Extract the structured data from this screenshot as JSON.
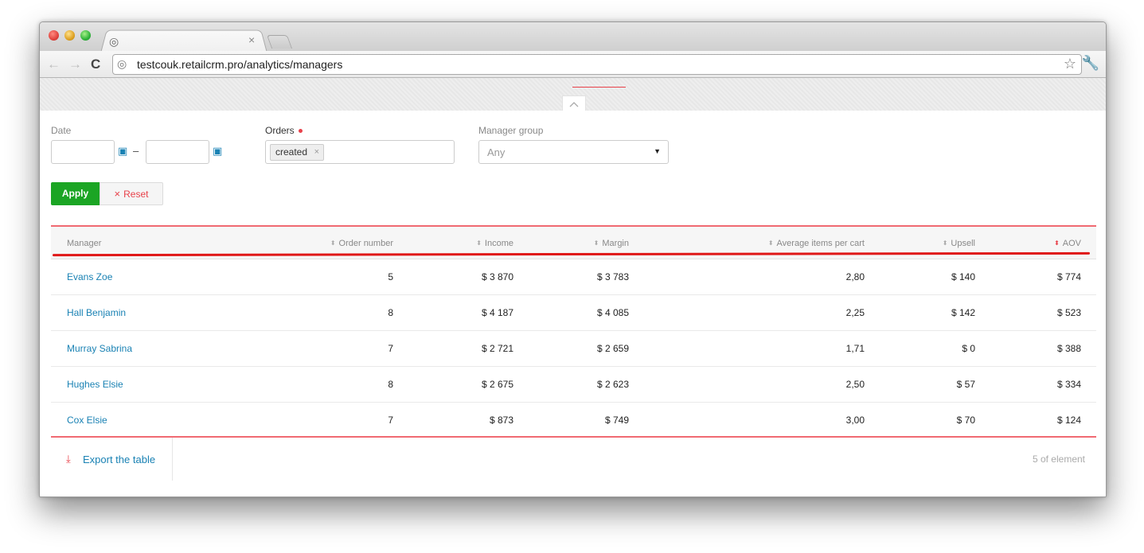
{
  "browser": {
    "url": "testcouk.retailcrm.pro/analytics/managers",
    "tab_close": "×",
    "back": "←",
    "forward": "→",
    "reload": "C",
    "star": "☆",
    "wrench": "🔧",
    "globe": "◎"
  },
  "filters": {
    "date_label": "Date",
    "date_dash": "–",
    "date_from": "",
    "date_to": "",
    "calendar_glyph": "▣",
    "orders_label": "Orders",
    "orders_tag": "created",
    "tag_remove": "×",
    "manager_group_label": "Manager group",
    "manager_group_value": "Any",
    "caret": "▼",
    "apply_label": "Apply",
    "reset_label": "Reset",
    "reset_glyph": "×"
  },
  "table": {
    "sort_glyph": "⬍",
    "columns": {
      "manager": "Manager",
      "order_number": "Order number",
      "income": "Income",
      "margin": "Margin",
      "avg_items": "Average items per cart",
      "upsell": "Upsell",
      "aov": "AOV"
    },
    "rows": [
      {
        "manager": "Evans Zoe",
        "order_number": "5",
        "income": "$ 3 870",
        "margin": "$ 3 783",
        "avg_items": "2,80",
        "upsell": "$ 140",
        "aov": "$ 774"
      },
      {
        "manager": "Hall Benjamin",
        "order_number": "8",
        "income": "$ 4 187",
        "margin": "$ 4 085",
        "avg_items": "2,25",
        "upsell": "$ 142",
        "aov": "$ 523"
      },
      {
        "manager": "Murray Sabrina",
        "order_number": "7",
        "income": "$ 2 721",
        "margin": "$ 2 659",
        "avg_items": "1,71",
        "upsell": "$ 0",
        "aov": "$ 388"
      },
      {
        "manager": "Hughes Elsie",
        "order_number": "8",
        "income": "$ 2 675",
        "margin": "$ 2 623",
        "avg_items": "2,50",
        "upsell": "$ 57",
        "aov": "$ 334"
      },
      {
        "manager": "Cox Elsie",
        "order_number": "7",
        "income": "$ 873",
        "margin": "$ 749",
        "avg_items": "3,00",
        "upsell": "$ 70",
        "aov": "$ 124"
      }
    ],
    "export_label": "Export the table",
    "export_glyph": "⤓",
    "count_text": "5 of element"
  }
}
